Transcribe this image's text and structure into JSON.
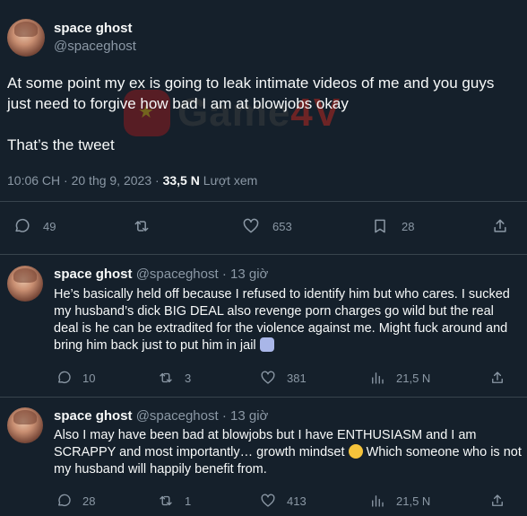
{
  "main": {
    "name": "space ghost",
    "handle": "@spaceghost",
    "text": "At some point my ex is going to leak intimate videos of me and you guys just need to forgive how bad I am at blowjobs okay\n\nThat’s the tweet",
    "time": "10:06 CH · 20 thg 9, 2023 · ",
    "views_count": "33,5 N",
    "views_label": " Lượt xem",
    "actions": {
      "replies": "49",
      "reposts": "",
      "likes": "653",
      "bookmarks": "28"
    }
  },
  "watermark": {
    "brand": "Game",
    "suffix": "4V"
  },
  "replies": [
    {
      "name": "space ghost",
      "handle": "@spaceghost",
      "sep": " · ",
      "time": "13 giờ",
      "text": "He’s basically held off because I refused to identify him but who cares. I sucked my husband’s dick BIG DEAL also revenge porn charges go wild but the real deal is he can be extradited for the violence against me. Might fuck around and bring him back just to put him in jail",
      "actions": {
        "replies": "10",
        "reposts": "3",
        "likes": "381",
        "views": "21,5 N"
      }
    },
    {
      "name": "space ghost",
      "handle": "@spaceghost",
      "sep": " · ",
      "time": "13 giờ",
      "text": "Also I may have been bad at blowjobs but I have ENTHUSIASM and I am SCRAPPY and most importantly… growth mindset",
      "text_tail": " Which someone who is not my husband will happily benefit from.",
      "actions": {
        "replies": "28",
        "reposts": "1",
        "likes": "413",
        "views": "21,5 N"
      }
    }
  ]
}
